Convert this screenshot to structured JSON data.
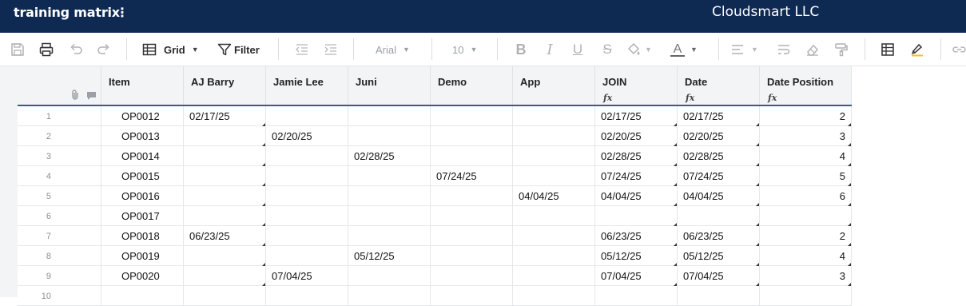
{
  "app": {
    "sheet_title": "training matrix",
    "menu_glyph": "⋮",
    "org_name": "Cloudsmart LLC"
  },
  "toolbar": {
    "grid_label": "Grid",
    "filter_label": "Filter",
    "font_name": "Arial",
    "font_size": "10",
    "bold_glyph": "B",
    "italic_glyph": "I",
    "underline_glyph": "U",
    "strike_glyph": "S",
    "text_color_glyph": "A",
    "icons": [
      "save-icon",
      "print-icon",
      "undo-icon",
      "redo-icon",
      "grid-icon",
      "filter-icon",
      "outdent-icon",
      "indent-icon",
      "bold-icon",
      "italic-icon",
      "underline-icon",
      "strikethrough-icon",
      "fill-color-icon",
      "text-color-icon",
      "align-icon",
      "wrap-icon",
      "clear-format-icon",
      "format-painter-icon",
      "table-icon",
      "highlight-icon",
      "link-icon"
    ]
  },
  "columns": [
    {
      "label": "Item",
      "formula": false
    },
    {
      "label": "AJ Barry",
      "formula": false
    },
    {
      "label": "Jamie Lee",
      "formula": false
    },
    {
      "label": "Juni",
      "formula": false
    },
    {
      "label": "Demo",
      "formula": false
    },
    {
      "label": "App",
      "formula": false
    },
    {
      "label": "JOIN",
      "formula": true
    },
    {
      "label": "Date",
      "formula": true
    },
    {
      "label": "Date Position",
      "formula": true
    }
  ],
  "formula_glyph": "fx",
  "rows": [
    {
      "n": "1",
      "cells": [
        "OP0012",
        "02/17/25",
        "",
        "",
        "",
        "",
        "02/17/25",
        "02/17/25",
        "2"
      ]
    },
    {
      "n": "2",
      "cells": [
        "OP0013",
        "",
        "02/20/25",
        "",
        "",
        "",
        "02/20/25",
        "02/20/25",
        "3"
      ]
    },
    {
      "n": "3",
      "cells": [
        "OP0014",
        "",
        "",
        "02/28/25",
        "",
        "",
        "02/28/25",
        "02/28/25",
        "4"
      ]
    },
    {
      "n": "4",
      "cells": [
        "OP0015",
        "",
        "",
        "",
        "07/24/25",
        "",
        "07/24/25",
        "07/24/25",
        "5"
      ]
    },
    {
      "n": "5",
      "cells": [
        "OP0016",
        "",
        "",
        "",
        "",
        "04/04/25",
        "04/04/25",
        "04/04/25",
        "6"
      ]
    },
    {
      "n": "6",
      "cells": [
        "OP0017",
        "",
        "",
        "",
        "",
        "",
        "",
        "",
        ""
      ]
    },
    {
      "n": "7",
      "cells": [
        "OP0018",
        "06/23/25",
        "",
        "",
        "",
        "",
        "06/23/25",
        "06/23/25",
        "2"
      ]
    },
    {
      "n": "8",
      "cells": [
        "OP0019",
        "",
        "",
        "05/12/25",
        "",
        "",
        "05/12/25",
        "05/12/25",
        "4"
      ]
    },
    {
      "n": "9",
      "cells": [
        "OP0020",
        "",
        "07/04/25",
        "",
        "",
        "",
        "07/04/25",
        "07/04/25",
        "3"
      ]
    },
    {
      "n": "10",
      "cells": [
        "",
        "",
        "",
        "",
        "",
        "",
        "",
        "",
        ""
      ]
    }
  ],
  "colors": {
    "title_bar": "#0f2a52",
    "header_bg": "#f3f4f6",
    "header_underline": "#3c5a8a",
    "highlight_accent": "#f6c21c"
  }
}
